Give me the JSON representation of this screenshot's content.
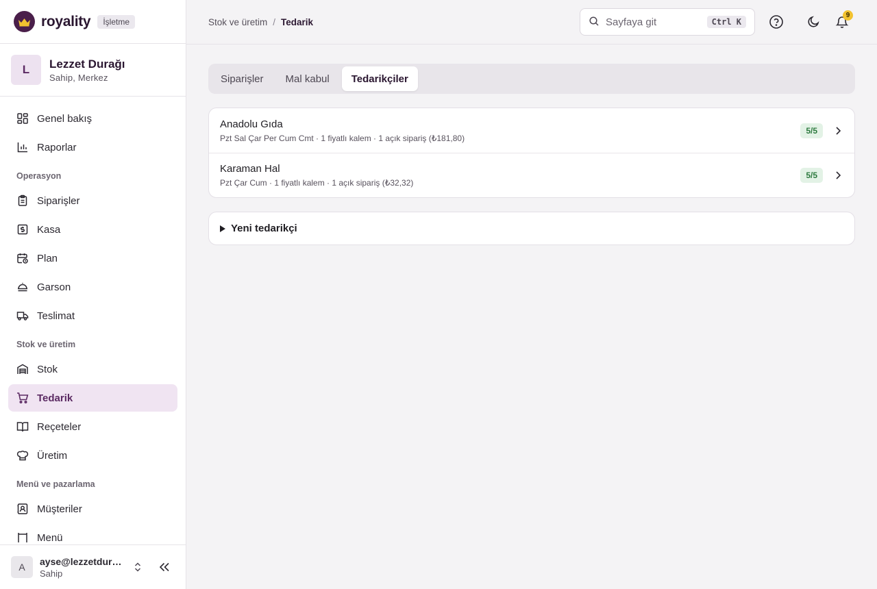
{
  "brand": {
    "name": "royality",
    "plan": "İşletme"
  },
  "org": {
    "initial": "L",
    "name": "Lezzet Durağı",
    "role": "Sahip, Merkez"
  },
  "nav": {
    "top": [
      {
        "label": "Genel bakış",
        "icon": "dashboard-icon"
      },
      {
        "label": "Raporlar",
        "icon": "chart-icon"
      }
    ],
    "sections": [
      {
        "title": "Operasyon",
        "items": [
          {
            "label": "Siparişler",
            "icon": "clipboard-icon"
          },
          {
            "label": "Kasa",
            "icon": "cash-icon"
          },
          {
            "label": "Plan",
            "icon": "calendar-clock-icon"
          },
          {
            "label": "Garson",
            "icon": "chef-hat-icon"
          },
          {
            "label": "Teslimat",
            "icon": "truck-icon"
          }
        ]
      },
      {
        "title": "Stok ve üretim",
        "items": [
          {
            "label": "Stok",
            "icon": "warehouse-icon"
          },
          {
            "label": "Tedarik",
            "icon": "cart-icon",
            "active": true
          },
          {
            "label": "Reçeteler",
            "icon": "book-icon"
          },
          {
            "label": "Üretim",
            "icon": "chef-icon"
          }
        ]
      },
      {
        "title": "Menü ve pazarlama",
        "items": [
          {
            "label": "Müşteriler",
            "icon": "contact-icon"
          },
          {
            "label": "Menü",
            "icon": "menu-icon"
          }
        ]
      }
    ]
  },
  "user": {
    "initial": "A",
    "email": "ayse@lezzetdurağı.com",
    "role": "Sahip"
  },
  "topbar": {
    "breadcrumb_parent": "Stok ve üretim",
    "breadcrumb_sep": "/",
    "breadcrumb_current": "Tedarik",
    "search_placeholder": "Sayfaya git",
    "search_shortcut": "Ctrl K",
    "notification_count": "9"
  },
  "tabs": [
    {
      "label": "Siparişler"
    },
    {
      "label": "Mal kabul"
    },
    {
      "label": "Tedarikçiler",
      "active": true
    }
  ],
  "suppliers": [
    {
      "name": "Anadolu Gıda",
      "meta": "Pzt Sal Çar Per Cum Cmt · 1 fiyatlı kalem · 1 açık sipariş (₺181,80)",
      "score": "5/5"
    },
    {
      "name": "Karaman Hal",
      "meta": "Pzt Çar Cum · 1 fiyatlı kalem · 1 açık sipariş (₺32,32)",
      "score": "5/5"
    }
  ],
  "new_supplier": {
    "label": "Yeni tedarikçi"
  },
  "colors": {
    "accent": "#5b2a63",
    "active_bg": "#f0e4f2",
    "score_bg": "#e3f2e6",
    "score_fg": "#2d7a3f",
    "badge": "#f2c230"
  }
}
